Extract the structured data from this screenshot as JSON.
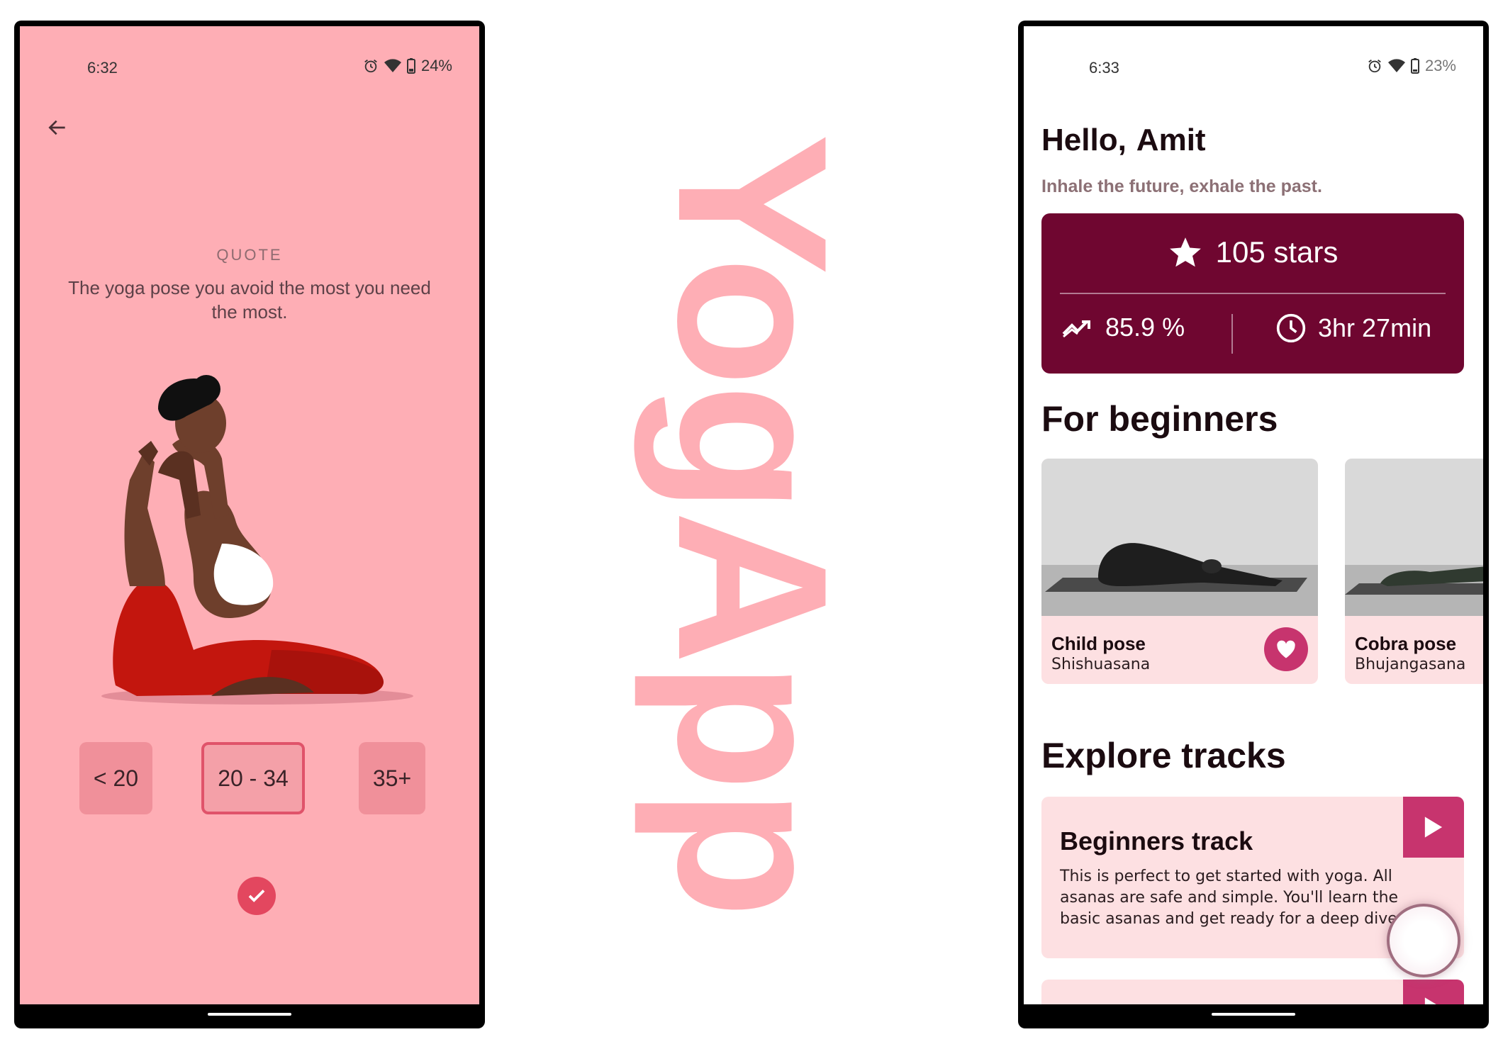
{
  "left_screen": {
    "status": {
      "time": "6:32",
      "battery": "24%"
    },
    "quote_label": "QUOTE",
    "quote_text": "The yoga pose you avoid the most you need the most.",
    "age_options": [
      "< 20",
      "20 - 34",
      "35+"
    ],
    "selected_age": "20 - 34"
  },
  "logo": {
    "text": "YogApp",
    "color": "#feaeb5"
  },
  "right_screen": {
    "status": {
      "time": "6:33",
      "battery": "23%"
    },
    "greeting": "Hello,",
    "user_name": "Amit",
    "tagline": "Inhale the future, exhale the past.",
    "stats": {
      "stars": "105 stars",
      "progress": "85.9 %",
      "time": "3hr 27min"
    },
    "beginners_title": "For beginners",
    "poses": [
      {
        "name": "Child pose",
        "sanskrit": "Shishuasana"
      },
      {
        "name": "Cobra pose",
        "sanskrit": "Bhujangasana"
      }
    ],
    "tracks_title": "Explore tracks",
    "tracks": [
      {
        "title": "Beginners track",
        "description": "This is perfect to get started with yoga. All asanas are safe and simple. You'll learn the basic asanas and get ready for a deep dive."
      }
    ]
  },
  "colors": {
    "left_background": "#feaeb5",
    "accent": "#c7346e",
    "stats_card": "#6f0630",
    "card_background": "#fde0e2"
  },
  "icons": [
    "back-arrow-icon",
    "alarm-icon",
    "wifi-icon",
    "battery-icon",
    "check-icon",
    "star-icon",
    "trending-up-icon",
    "clock-icon",
    "heart-icon",
    "play-icon"
  ]
}
